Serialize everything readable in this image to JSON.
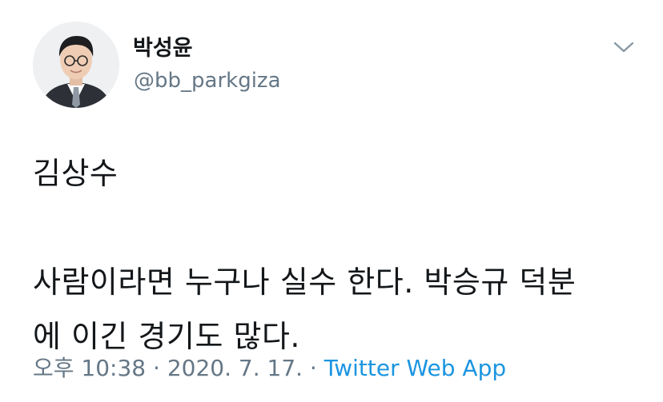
{
  "tweet": {
    "author": {
      "display_name": "박성윤",
      "handle": "@bb_parkgiza"
    },
    "text": "김상수\n\n사람이라면 누구나 실수 한다. 박승규 덕분\n에 이긴 경기도 많다.",
    "meta": {
      "time": "오후 10:38",
      "separator1": " · ",
      "date": "2020. 7. 17.",
      "separator2": " · ",
      "source": "Twitter Web App"
    },
    "menu_icon": "chevron-down-icon",
    "colors": {
      "text": "#14171a",
      "secondary": "#657786",
      "link": "#1b95e0",
      "background": "#ffffff"
    }
  }
}
